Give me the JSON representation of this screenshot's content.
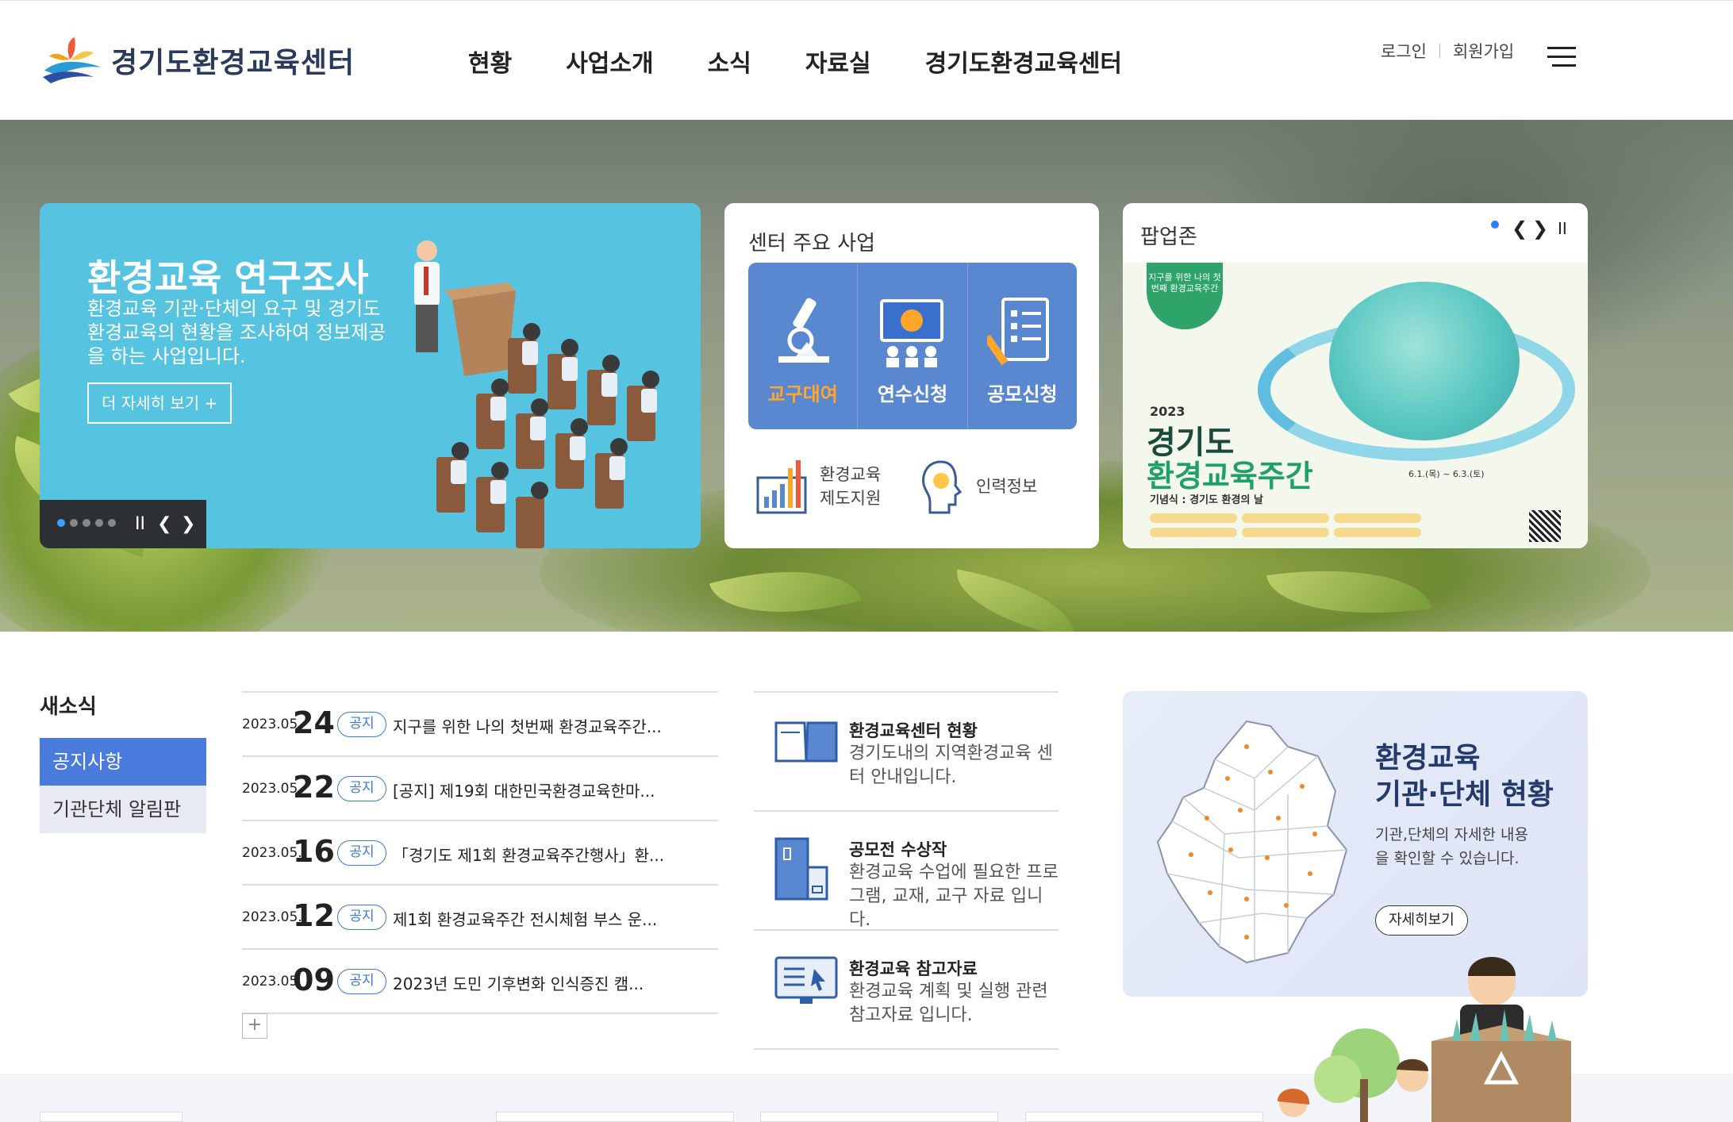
{
  "header": {
    "logo_text": "경기도환경교육센터",
    "nav": [
      "현황",
      "사업소개",
      "소식",
      "자료실",
      "경기도환경교육센터"
    ],
    "login": "로그인",
    "signup": "회원가입"
  },
  "hero": {
    "research": {
      "title": "환경교육 연구조사",
      "desc": "환경교육 기관·단체의 요구 및 경기도환경교육의 현황을 조사하여 정보제공을 하는 사업입니다.",
      "more": "더 자세히 보기 +",
      "slides": 5,
      "active_slide": 1
    },
    "business": {
      "title": "센터 주요 사업",
      "items": [
        "교구대여",
        "연수신청",
        "공모신청"
      ],
      "sub1": "환경교육\n제도지원",
      "sub1_a": "환경교육",
      "sub1_b": "제도지원",
      "sub2": "인력정보"
    },
    "popup": {
      "title": "팝업존",
      "poster": {
        "badge": "지구를 위한 나의 첫번째 환경교육주간",
        "year": "2023",
        "line1": "경기도",
        "line2": "환경교육주간",
        "dates": "6.1.(목) ~ 6.3.(토)",
        "sub": "기념식 : 경기도 환경의 날"
      }
    }
  },
  "news": {
    "title": "새소식",
    "tabs": [
      "공지사항",
      "기관단체 알림판"
    ],
    "rows": [
      {
        "ym": "2023.05.",
        "dd": "24",
        "tag": "공지",
        "title": "지구를 위한 나의 첫번째 환경교육주간..."
      },
      {
        "ym": "2023.05.",
        "dd": "22",
        "tag": "공지",
        "title": "[공지] 제19회 대한민국환경교육한마..."
      },
      {
        "ym": "2023.05.",
        "dd": "16",
        "tag": "공지",
        "title": "「경기도 제1회 환경교육주간행사」환..."
      },
      {
        "ym": "2023.05.",
        "dd": "12",
        "tag": "공지",
        "title": "제1회 환경교육주간 전시체험 부스 운..."
      },
      {
        "ym": "2023.05.",
        "dd": "09",
        "tag": "공지",
        "title": "2023년 도민 기후변화 인식증진 캠..."
      }
    ],
    "more": "+"
  },
  "info": [
    {
      "title": "환경교육센터 현황",
      "desc": "경기도내의 지역환경교육 센터 안내입니다.",
      "icon": "book-icon"
    },
    {
      "title": "공모전 수상작",
      "desc": "환경교육 수업에 필요한 프로그램, 교재, 교구 자료 입니다.",
      "icon": "cabinet-icon"
    },
    {
      "title": "환경교육 참고자료",
      "desc": "환경교육 계획 및 실행 관련 참고자료 입니다.",
      "icon": "monitor-icon"
    }
  ],
  "map": {
    "title_a": "환경교육",
    "title_b": "기관·단체 현황",
    "desc": "기관,단체의 자세한 내용을 확인할 수 있습니다.",
    "button": "자세히보기"
  },
  "colors": {
    "accent": "#4a7bdc",
    "hero_card": "#56c4e0",
    "biz_bg": "#5a88d0",
    "orange": "#ffa62b"
  }
}
